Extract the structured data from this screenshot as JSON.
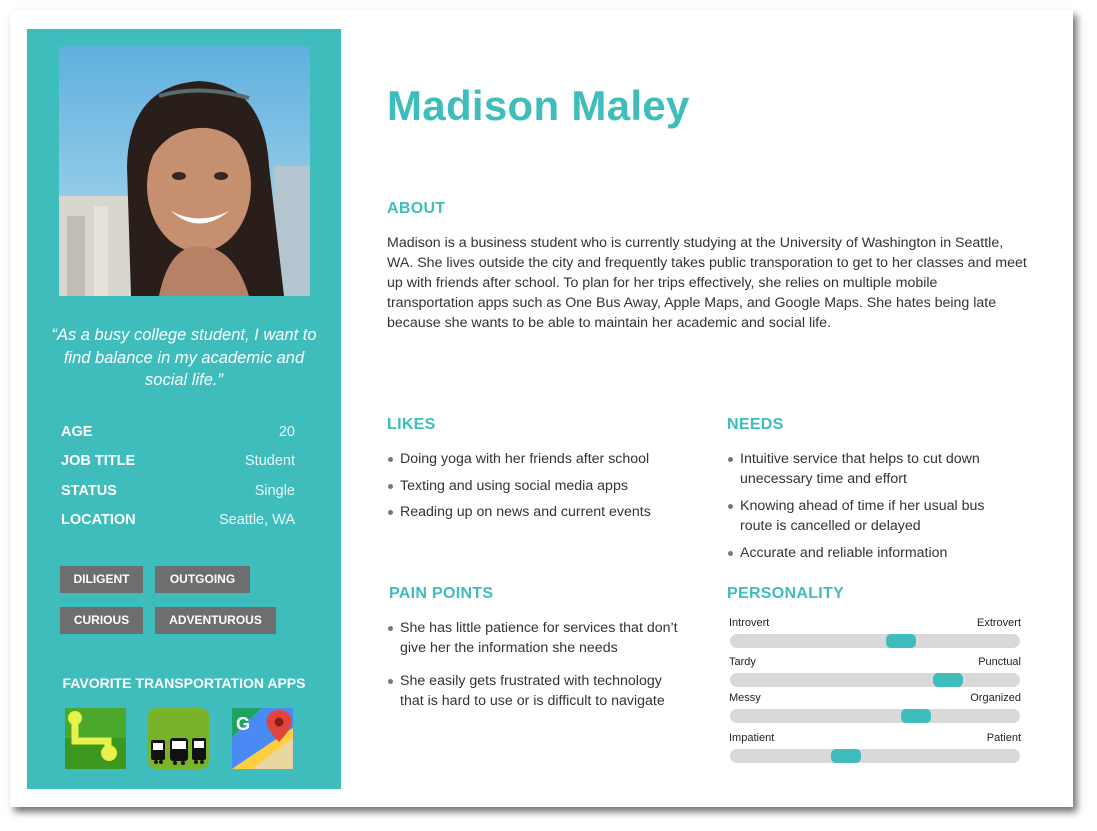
{
  "persona": {
    "name": "Madison Maley",
    "quote": "“As a busy college student, I want to find balance in my academic and social life.”",
    "facts": [
      {
        "label": "AGE",
        "value": "20"
      },
      {
        "label": "JOB TITLE",
        "value": "Student"
      },
      {
        "label": "STATUS",
        "value": "Single"
      },
      {
        "label": "LOCATION",
        "value": "Seattle, WA"
      }
    ],
    "traits": [
      "DILIGENT",
      "OUTGOING",
      "CURIOUS",
      "ADVENTUROUS"
    ],
    "apps_title": "FAVORITE TRANSPORTATION APPS",
    "apps": [
      "one-bus-away-app-icon",
      "transit-app-icon",
      "google-maps-app-icon"
    ]
  },
  "about": {
    "heading": "ABOUT",
    "text": "Madison is a business student who is currently studying at the University of Washington in Seattle, WA. She lives outside the city and frequently takes public transporation to get to her classes and meet up with friends after school. To plan for her trips effectively, she relies on multiple mobile transportation apps such as One Bus Away, Apple Maps, and Google Maps. She hates being late because she wants to be able to maintain her academic and social life."
  },
  "likes": {
    "heading": "LIKES",
    "items": [
      "Doing yoga with her friends after school",
      "Texting and using social media apps",
      "Reading up on news and current events"
    ]
  },
  "needs": {
    "heading": "NEEDS",
    "items": [
      "Intuitive service that helps to cut down unecessary time and effort",
      "Knowing ahead of time if her usual bus route is cancelled or delayed",
      "Accurate and reliable information"
    ]
  },
  "pain_points": {
    "heading": "PAIN POINTS",
    "items": [
      "She has little patience for services that don’t give her the information she needs",
      "She easily gets frustrated with technology that is hard to use or is difficult to navigate"
    ]
  },
  "personality": {
    "heading": "PERSONALITY",
    "scales": [
      {
        "left": "Introvert",
        "right": "Extrovert",
        "level": 0.59
      },
      {
        "left": "Tardy",
        "right": "Punctual",
        "level": 0.75
      },
      {
        "left": "Messy",
        "right": "Organized",
        "level": 0.64
      },
      {
        "left": "Impatient",
        "right": "Patient",
        "level": 0.4
      }
    ]
  },
  "colors": {
    "accent": "#3fbcbc",
    "tag": "#6e6e6e",
    "track": "#d9d9d9"
  }
}
